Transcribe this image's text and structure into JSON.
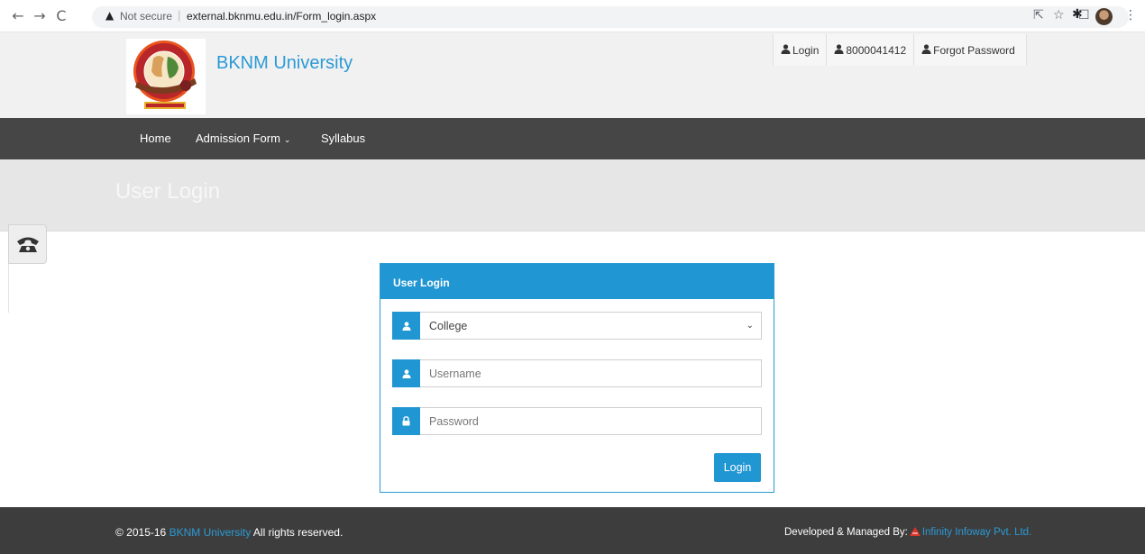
{
  "browser": {
    "security_label": "Not secure",
    "separator": "|",
    "url": "external.bknmu.edu.in/Form_login.aspx"
  },
  "header": {
    "brand_name": "BKNM University",
    "top_links": {
      "login": "Login",
      "phone": "8000041412",
      "forgot_password": "Forgot Password"
    }
  },
  "nav": {
    "home": "Home",
    "admission_form": "Admission Form",
    "syllabus": "Syllabus"
  },
  "banner": {
    "title": "User Login"
  },
  "login_card": {
    "title": "User Login",
    "select_value": "College",
    "username_placeholder": "Username",
    "password_placeholder": "Password",
    "login_button": "Login"
  },
  "footer": {
    "copyright_prefix": "© 2015-16",
    "copyright_link": "BKNM University",
    "copyright_suffix": "All rights reserved.",
    "developed_by": "Developed & Managed By:",
    "developer_link": "Infinity Infoway Pvt. Ltd."
  },
  "colors": {
    "accent": "#2096d3",
    "nav_bg": "#464646",
    "footer_bg": "#3d3d3d",
    "header_bg": "#f1f1f1"
  },
  "icons": [
    "back-icon",
    "forward-icon",
    "reload-icon",
    "warning-icon",
    "share-icon",
    "star-icon",
    "extensions-icon",
    "sidepanel-icon",
    "profile-avatar",
    "menu-icon",
    "user-icon",
    "lock-icon",
    "phone-icon"
  ]
}
